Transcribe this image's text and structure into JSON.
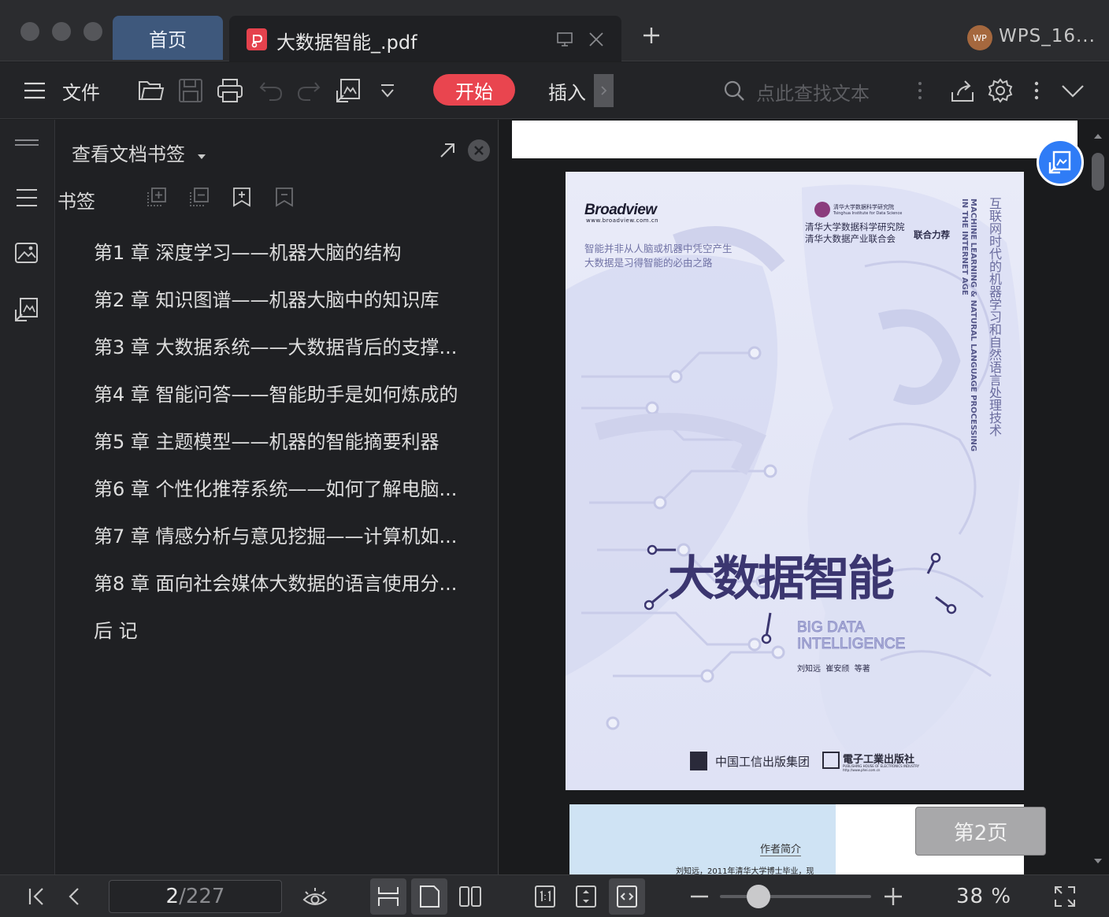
{
  "titlebar": {
    "tabs": [
      {
        "label": "首页"
      },
      {
        "label": "大数据智能_.pdf"
      }
    ],
    "new_tab_symbol": "+",
    "account": {
      "avatar_text": "WP",
      "name": "WPS_16..."
    }
  },
  "toolbar": {
    "menu_label": "文件",
    "start_label": "开始",
    "insert_label": "插入",
    "search_placeholder": "点此查找文本"
  },
  "panel": {
    "title": "查看文档书签",
    "section_label": "书签",
    "bookmarks": [
      "第1 章 深度学习——机器大脑的结构",
      "第2 章 知识图谱——机器大脑中的知识库",
      "第3 章 大数据系统——大数据背后的支撑...",
      "第4 章 智能问答——智能助手是如何炼成的",
      "第5 章 主题模型——机器的智能摘要利器",
      "第6 章 个性化推荐系统——如何了解电脑...",
      "第7 章 情感分析与意见挖掘——计算机如...",
      "第8 章 面向社会媒体大数据的语言使用分...",
      "后 记"
    ]
  },
  "document": {
    "cover": {
      "publisher_logo": "Broadview",
      "publisher_url": "www.broadview.com.cn",
      "tagline_1": "智能并非从人脑或机器中凭空产生",
      "tagline_2": "大数据是习得智能的必由之路",
      "institute_small": "清华大学数据科学研究院",
      "institute_small_en": "Tsinghua Institute for Data Science",
      "recommend_line_1": "清华大学数据科学研究院",
      "recommend_line_2": "清华大数据产业联合会",
      "recommend_suffix": "联合力荐",
      "vertical_cn": "互联网时代的机器学习和自然语言处理技术",
      "vertical_en_1": "MACHINE LEARNING & NATURAL LANGUAGE PROCESSING",
      "vertical_en_2": "IN THE INTERNET AGE",
      "title_cn": "大数据智能",
      "title_en_1": "BIG DATA",
      "title_en_2": "INTELLIGENCE",
      "authors": "刘知远  崔安颀  等著",
      "publisher_1": "中国工信出版集团",
      "publisher_2": "電子工業出版社",
      "publisher_2_en": "PUBLISHING HOUSE OF ELECTRONICS INDUSTRY",
      "publisher_2_url": "http://www.phei.com.cn"
    },
    "page2": {
      "heading": "作者简介",
      "text": "刘知远，2011年清华大学博士毕业，现"
    },
    "page_tag": "第2页"
  },
  "statusbar": {
    "current_page": "2",
    "separator": "/",
    "total_pages": "227",
    "zoom": "38 %",
    "zoom_level_percent": 38
  },
  "colors": {
    "accent_red": "#e9454f",
    "home_tab_blue": "#3e587c",
    "float_button_blue": "#2f7cf6",
    "cover_purple": "#3b3670"
  }
}
